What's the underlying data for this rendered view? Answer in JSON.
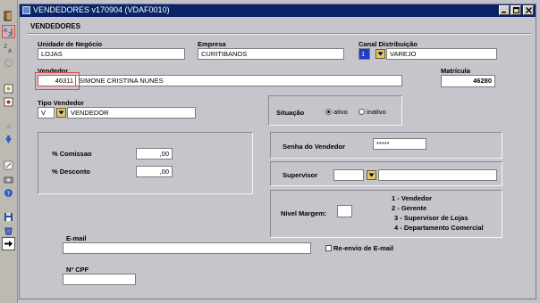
{
  "window": {
    "title": "VENDEDORES v170904 (VDAF0010)"
  },
  "section": {
    "title": "VENDEDORES"
  },
  "toolbar": {
    "icons": [
      "exit-icon",
      "sort-ascending-icon",
      "sort-descending-icon",
      "refresh-icon",
      "insert-record-icon",
      "delete-record-icon",
      "previous-icon",
      "next-icon",
      "edit-icon",
      "camera-icon",
      "help-icon",
      "save-icon",
      "clear-icon",
      "exit-arrow-icon"
    ]
  },
  "fields": {
    "unidade": {
      "label": "Unidade de Negócio",
      "value": "LOJAS"
    },
    "empresa": {
      "label": "Empresa",
      "value": "CURITIBANOS"
    },
    "canal": {
      "label": "Canal Distribuição",
      "code": "1",
      "value": "VAREJO"
    },
    "vendedor": {
      "label": "Vendedor",
      "code": "46311",
      "name": "SIMONE CRISTINA NUNES"
    },
    "matricula": {
      "label": "Matrícula",
      "value": "46280"
    },
    "tipo": {
      "label": "Tipo Vendedor",
      "code": "V",
      "value": "VENDEDOR"
    },
    "situacao": {
      "label": "Situação",
      "options": [
        "ativo",
        "inativo"
      ],
      "selected": "ativo"
    },
    "comissao": {
      "label": "% Comissao",
      "value": ",00"
    },
    "desconto": {
      "label": "% Desconto",
      "value": ",00"
    },
    "senha": {
      "label": "Senha do Vendedor",
      "value": "*****"
    },
    "supervisor": {
      "label": "Supervisor",
      "code": "",
      "name": ""
    },
    "nivel": {
      "label": "Nivel Margem:",
      "value": "",
      "legend": [
        "1 - Vendedor",
        "2 - Gerente",
        "3 - Supervisor de Lojas",
        "4 - Departamento Comercial"
      ]
    },
    "email": {
      "label": "E-mail",
      "value": "",
      "resend_label": "Re-envio de E-mail",
      "resend_checked": false
    },
    "cpf": {
      "label": "Nº CPF",
      "value": ""
    }
  },
  "colors": {
    "title_bar": "#0a246a",
    "highlight": "#d64a4a",
    "dropdown": "#e0c870"
  }
}
